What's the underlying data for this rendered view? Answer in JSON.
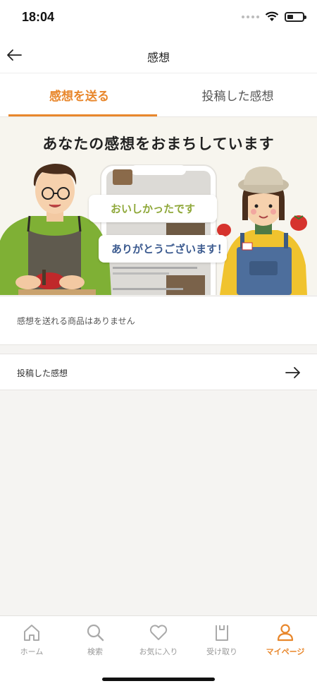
{
  "status": {
    "time": "18:04"
  },
  "nav": {
    "title": "感想"
  },
  "tabs": [
    {
      "label": "感想を送る",
      "active": true
    },
    {
      "label": "投稿した感想",
      "active": false
    }
  ],
  "banner": {
    "title": "あなたの感想をおまちしています",
    "bubble_1": "おいしかったです",
    "bubble_2": "ありがとうございます！"
  },
  "empty_message": "感想を送れる商品はありません",
  "posted_link": {
    "label": "投稿した感想"
  },
  "tab_bar": [
    {
      "label": "ホーム",
      "icon": "home-icon",
      "active": false
    },
    {
      "label": "検索",
      "icon": "search-icon",
      "active": false
    },
    {
      "label": "お気に入り",
      "icon": "heart-icon",
      "active": false
    },
    {
      "label": "受け取り",
      "icon": "bag-icon",
      "active": false
    },
    {
      "label": "マイページ",
      "icon": "person-icon",
      "active": true
    }
  ],
  "colors": {
    "accent": "#e8872c",
    "background": "#f5f4f2"
  }
}
